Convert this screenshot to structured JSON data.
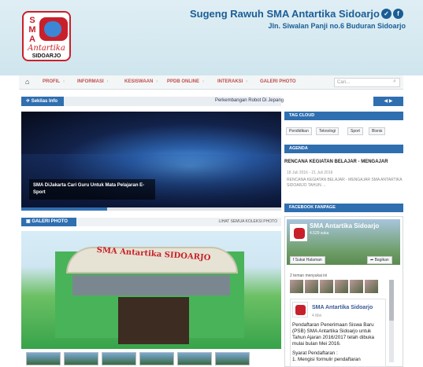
{
  "header": {
    "logo": {
      "letters": "SMA",
      "script": "Antartika",
      "city": "SIDOARJO"
    },
    "title": "Sugeng Rawuh SMA Antartika Sidoarjo",
    "subtitle": "Jln. Siwalan Panji no.6 Buduran Sidoarjo",
    "social": {
      "twitter": "✓",
      "facebook": "f"
    }
  },
  "nav": {
    "home_icon": "home-icon",
    "items": [
      "PROFIL",
      "INFORMASI",
      "KESISWAAN",
      "PPDB ONLINE",
      "INTERAKSI",
      "GALERI PHOTO"
    ],
    "search_placeholder": "Cari..."
  },
  "ticker": {
    "label": "Sekilas Info",
    "text": "Perkembangan Robot Di Jepang"
  },
  "slider": {
    "caption": "SMA DiJakarta Cari Guru Untuk Mata Pelajaran E-Sport",
    "progress": 0.33
  },
  "galeri": {
    "label": "GALERI PHOTO",
    "link": "LIHAT SEMUA KOLEKSI PHOTO",
    "roof_text": "SMA Antartika SIDOARJO"
  },
  "sidebar": {
    "tag_cloud": {
      "title": "TAG CLOUD",
      "tags": [
        "Pendidikan",
        "Teknologi",
        "Sport",
        "Bisnis"
      ]
    },
    "agenda": {
      "title": "AGENDA",
      "item_title": "RENCANA KEGIATAN BELAJAR - MENGAJAR",
      "meta": "18 Juli 2016 - 21 Juli 2016",
      "desc": "RENCANA KEGIATAN BELAJAR - MENGAJAR SMA ANTARTIKA SIDOARJO TAHUN ..."
    },
    "facebook": {
      "title": "FACEBOOK FANPAGE",
      "page_name": "SMA Antartika Sidoarjo",
      "likes": "4.529 suka",
      "like_button": "Sukai Halaman",
      "share_button": "Bagikan",
      "friends_text": "2 teman menyukai ini",
      "post_name": "SMA Antartika Sidoarjo",
      "post_time": "4 Mei",
      "post_text_1": "Pendaftaran Penerimaan Siswa Baru (PSB) SMA Antartika Sidoarjo untuk Tahun Ajaran 2016/2017 telah dibuka mulai bulan Mei 2016.",
      "post_text_2": "Syarat Pendaftaran :",
      "post_text_3": "1. Mengisi formulir pendaftaran"
    }
  },
  "colors": {
    "primary": "#2f6fb0",
    "title": "#1b5e96",
    "nav": "#c14e4e",
    "brand_red": "#c8202a"
  }
}
